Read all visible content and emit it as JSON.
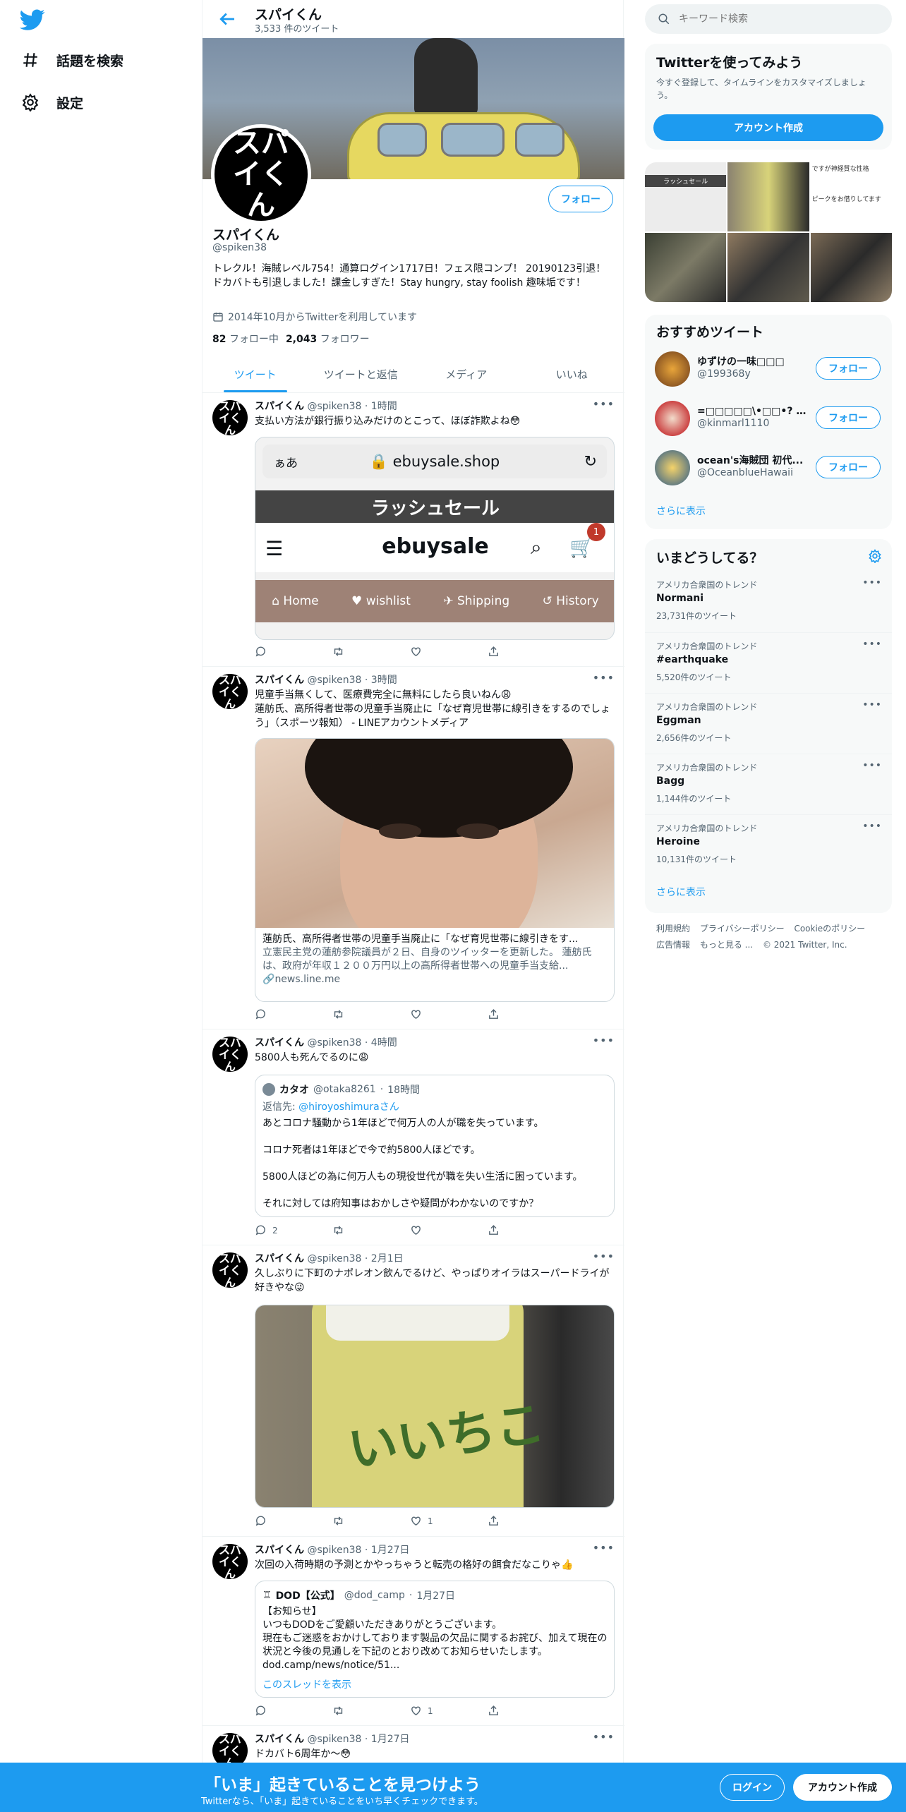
{
  "nav": {
    "explore_label": "話題を検索",
    "settings_label": "設定"
  },
  "profile": {
    "header_name": "スパイくん",
    "tweet_count": "3,533 件のツイート",
    "name": "スパイくん",
    "handle": "@spiken38",
    "avatar_text": "スパイくん",
    "follow_label": "フォロー",
    "bio": "トレクル！海賊レベル754！通算ログイン1717日！フェス限コンプ！ 20190123引退！ ドカバトも引退しました！課金しすぎた！Stay hungry, stay foolish 趣味垢です！",
    "joined": "2014年10月からTwitterを利用しています",
    "following_count": "82",
    "following_label": "フォロー中",
    "followers_count": "2,043",
    "followers_label": "フォロワー"
  },
  "tabs": [
    "ツイート",
    "ツイートと返信",
    "メディア",
    "いいね"
  ],
  "tweets": [
    {
      "name": "スパイくん",
      "handle": "@spiken38",
      "time": "1時間",
      "text": "支払い方法が銀行振り込みだけのとこって、ほぼ詐欺よね😳",
      "card": {
        "aa": "ぁあ",
        "url": "ebuysale.shop",
        "sale": "ラッシュセール",
        "logo": "ebuysale",
        "cart_count": "1",
        "nav": [
          "Home",
          "wishlist",
          "Shipping",
          "History"
        ]
      },
      "replies": "",
      "retweets": "",
      "likes": ""
    },
    {
      "name": "スパイくん",
      "handle": "@spiken38",
      "time": "3時間",
      "text": "児童手当無くして、医療費完全に無料にしたら良いねん😩\n蓮舫氏、高所得者世帯の児童手当廃止に「なぜ育児世帯に線引きをするのでしょう」（スポーツ報知） - LINEアカウントメディア",
      "link": {
        "title": "蓮舫氏、高所得者世帯の児童手当廃止に「なぜ育児世帯に線引きをす...",
        "desc": "立憲民主党の蓮舫参院議員が２日、自身のツイッターを更新した。 蓮舫氏は、政府が年収１２００万円以上の高所得者世帯への児童手当支給...",
        "domain": "news.line.me"
      },
      "replies": "",
      "retweets": "",
      "likes": ""
    },
    {
      "name": "スパイくん",
      "handle": "@spiken38",
      "time": "4時間",
      "text": "5800人も死んでるのに😩",
      "quote": {
        "name": "カタオ",
        "handle": "@otaka8261",
        "time": "18時間",
        "reply_to_label": "返信先:",
        "reply_to": "@hiroyoshimuraさん",
        "p1": "あとコロナ騒動から1年ほどで何万人の人が職を失っています。",
        "p2": "コロナ死者は1年ほどで今で約5800人ほどです。",
        "p3": "5800人ほどの為に何万人もの現役世代が職を失い生活に困っています。",
        "p4": "それに対しては府知事はおかしさや疑問がわかないのですか？"
      },
      "replies": "2",
      "retweets": "",
      "likes": ""
    },
    {
      "name": "スパイくん",
      "handle": "@spiken38",
      "time": "2月1日",
      "text": "久しぶりに下町のナポレオン飲んでるけど、やっぱりオイラはスーパードライが好きやな😜",
      "photo_label": "いいちこ",
      "replies": "",
      "retweets": "",
      "likes": "1"
    },
    {
      "name": "スパイくん",
      "handle": "@spiken38",
      "time": "1月27日",
      "text": "次回の入荷時期の予測とかやっちゃうと転売の格好の餌食だなこりゃ👍",
      "quote": {
        "name": "DOD【公式】",
        "handle": "@dod_camp",
        "time": "1月27日",
        "l1": "【お知らせ】",
        "l2": "いつもDODをご愛顧いただきありがとうございます。",
        "l3": "現在もご迷惑をおかけしております製品の欠品に関するお詫び、加えて現在の状況と今後の見通しを下記のとおり改めてお知らせいたします。",
        "l4": "dod.camp/news/notice/51...",
        "thread_link": "このスレッドを表示"
      },
      "replies": "",
      "retweets": "",
      "likes": "1"
    },
    {
      "name": "スパイくん",
      "handle": "@spiken38",
      "time": "1月27日",
      "text": "ドカバト6周年か〜😳"
    }
  ],
  "sidebar": {
    "search_placeholder": "キーワード検索",
    "signup_title": "Twitterを使ってみよう",
    "signup_desc": "今すぐ登録して、タイムラインをカスタマイズしましょう。",
    "signup_button": "アカウント作成",
    "thumb_text_1": "ラッシュセール",
    "thumb_text_2": "ですが神経質な性格",
    "thumb_text_3": "ピークをお借りしてます",
    "recommended_title": "おすすめツイート",
    "recommended": [
      {
        "name": "ゆずけの一味□□□",
        "handle": "@199368y",
        "follow": "フォロー"
      },
      {
        "name": "=□□□□□\\•□□•? きん…",
        "handle": "@kinmarl1110",
        "follow": "フォロー"
      },
      {
        "name": "ocean's海賊団 初代...",
        "handle": "@OceanblueHawaii",
        "follow": "フォロー"
      }
    ],
    "show_more": "さらに表示",
    "trends_title": "いまどうしてる？",
    "trends": [
      {
        "context": "アメリカ合衆国のトレンド",
        "name": "Normani",
        "count": "23,731件のツイート"
      },
      {
        "context": "アメリカ合衆国のトレンド",
        "name": "#earthquake",
        "count": "5,520件のツイート"
      },
      {
        "context": "アメリカ合衆国のトレンド",
        "name": "Eggman",
        "count": "2,656件のツイート"
      },
      {
        "context": "アメリカ合衆国のトレンド",
        "name": "Bagg",
        "count": "1,144件のツイート"
      },
      {
        "context": "アメリカ合衆国のトレンド",
        "name": "Heroine",
        "count": "10,131件のツイート"
      }
    ],
    "trends_show_more": "さらに表示",
    "footer": [
      "利用規約",
      "プライバシーポリシー",
      "Cookieのポリシー",
      "広告情報",
      "もっと見る ...",
      "© 2021 Twitter, Inc."
    ]
  },
  "bottom_bar": {
    "title": "「いま」起きていることを見つけよう",
    "subtitle": "Twitterなら、「いま」起きていることをいち早くチェックできます。",
    "login": "ログイン",
    "signup": "アカウント作成"
  },
  "colors": {
    "accent": "#1d9bf0",
    "text": "#0f1419",
    "muted": "#536471"
  }
}
